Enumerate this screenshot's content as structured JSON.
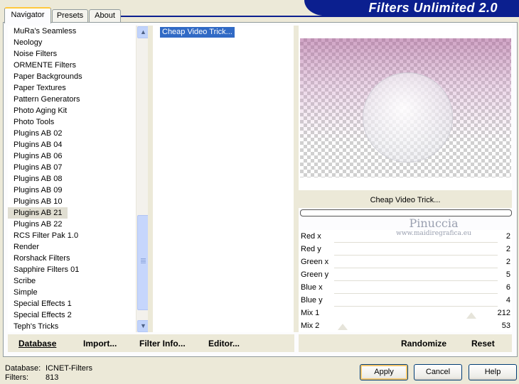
{
  "header": {
    "title": "Filters Unlimited 2.0"
  },
  "tabs": [
    {
      "label": "Navigator",
      "active": true
    },
    {
      "label": "Presets",
      "active": false
    },
    {
      "label": "About",
      "active": false
    }
  ],
  "categories": [
    "MuRa's Seamless",
    "Neology",
    "Noise Filters",
    "ORMENTE Filters",
    "Paper Backgrounds",
    "Paper Textures",
    "Pattern Generators",
    "Photo Aging Kit",
    "Photo Tools",
    "Plugins AB 02",
    "Plugins AB 04",
    "Plugins AB 06",
    "Plugins AB 07",
    "Plugins AB 08",
    "Plugins AB 09",
    "Plugins AB 10",
    "Plugins AB 21",
    "Plugins AB 22",
    "RCS Filter Pak 1.0",
    "Render",
    "Rorshack Filters",
    "Sapphire Filters 01",
    "Scribe",
    "Simple",
    "Special Effects 1",
    "Special Effects 2",
    "Teph's Tricks"
  ],
  "selected_category": "Plugins AB 21",
  "filters": [
    "Cheap Video Trick..."
  ],
  "preview": {
    "label": "Cheap Video Trick...",
    "watermark_name": "Pinuccia",
    "watermark_url": "www.maidiregrafica.eu"
  },
  "params": [
    {
      "name": "Red x",
      "value": "2"
    },
    {
      "name": "Red y",
      "value": "2"
    },
    {
      "name": "Green x",
      "value": "2"
    },
    {
      "name": "Green y",
      "value": "5"
    },
    {
      "name": "Blue x",
      "value": "6"
    },
    {
      "name": "Blue y",
      "value": "4"
    },
    {
      "name": "Mix 1",
      "value": "212"
    },
    {
      "name": "Mix 2",
      "value": "53"
    }
  ],
  "toolbar": {
    "database": "Database",
    "import": "Import...",
    "filter_info": "Filter Info...",
    "editor": "Editor...",
    "randomize": "Randomize",
    "reset": "Reset"
  },
  "status": {
    "database_label": "Database:",
    "database_value": "ICNET-Filters",
    "filters_label": "Filters:",
    "filters_value": "813"
  },
  "buttons": {
    "apply": "Apply",
    "cancel": "Cancel",
    "help": "Help"
  },
  "colors": {
    "banner": "#0b1f8f",
    "selection": "#316ac5"
  }
}
